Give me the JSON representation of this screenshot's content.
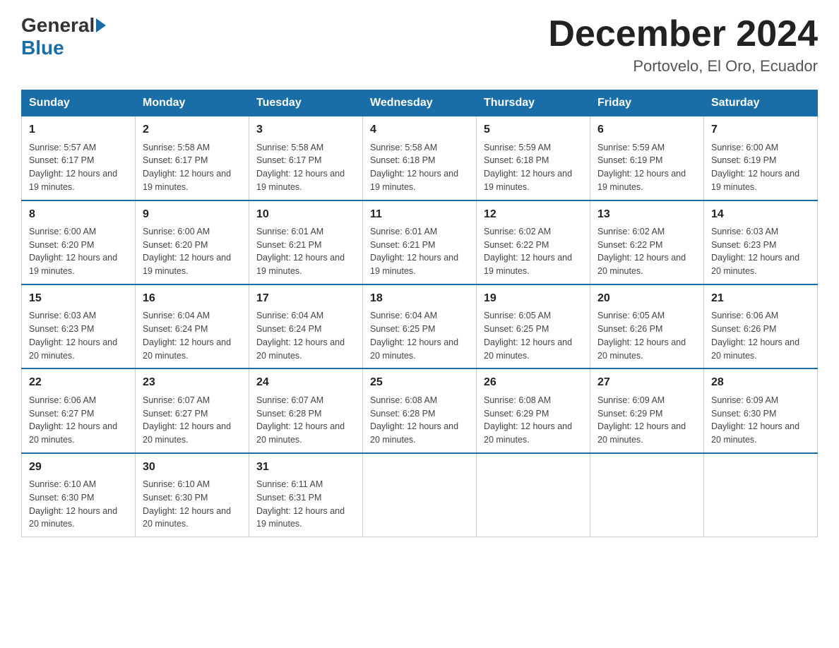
{
  "header": {
    "logo_general": "General",
    "logo_blue": "Blue",
    "month_year": "December 2024",
    "location": "Portovelo, El Oro, Ecuador"
  },
  "calendar": {
    "days_of_week": [
      "Sunday",
      "Monday",
      "Tuesday",
      "Wednesday",
      "Thursday",
      "Friday",
      "Saturday"
    ],
    "weeks": [
      [
        {
          "day": "1",
          "sunrise": "5:57 AM",
          "sunset": "6:17 PM",
          "daylight": "12 hours and 19 minutes."
        },
        {
          "day": "2",
          "sunrise": "5:58 AM",
          "sunset": "6:17 PM",
          "daylight": "12 hours and 19 minutes."
        },
        {
          "day": "3",
          "sunrise": "5:58 AM",
          "sunset": "6:17 PM",
          "daylight": "12 hours and 19 minutes."
        },
        {
          "day": "4",
          "sunrise": "5:58 AM",
          "sunset": "6:18 PM",
          "daylight": "12 hours and 19 minutes."
        },
        {
          "day": "5",
          "sunrise": "5:59 AM",
          "sunset": "6:18 PM",
          "daylight": "12 hours and 19 minutes."
        },
        {
          "day": "6",
          "sunrise": "5:59 AM",
          "sunset": "6:19 PM",
          "daylight": "12 hours and 19 minutes."
        },
        {
          "day": "7",
          "sunrise": "6:00 AM",
          "sunset": "6:19 PM",
          "daylight": "12 hours and 19 minutes."
        }
      ],
      [
        {
          "day": "8",
          "sunrise": "6:00 AM",
          "sunset": "6:20 PM",
          "daylight": "12 hours and 19 minutes."
        },
        {
          "day": "9",
          "sunrise": "6:00 AM",
          "sunset": "6:20 PM",
          "daylight": "12 hours and 19 minutes."
        },
        {
          "day": "10",
          "sunrise": "6:01 AM",
          "sunset": "6:21 PM",
          "daylight": "12 hours and 19 minutes."
        },
        {
          "day": "11",
          "sunrise": "6:01 AM",
          "sunset": "6:21 PM",
          "daylight": "12 hours and 19 minutes."
        },
        {
          "day": "12",
          "sunrise": "6:02 AM",
          "sunset": "6:22 PM",
          "daylight": "12 hours and 19 minutes."
        },
        {
          "day": "13",
          "sunrise": "6:02 AM",
          "sunset": "6:22 PM",
          "daylight": "12 hours and 20 minutes."
        },
        {
          "day": "14",
          "sunrise": "6:03 AM",
          "sunset": "6:23 PM",
          "daylight": "12 hours and 20 minutes."
        }
      ],
      [
        {
          "day": "15",
          "sunrise": "6:03 AM",
          "sunset": "6:23 PM",
          "daylight": "12 hours and 20 minutes."
        },
        {
          "day": "16",
          "sunrise": "6:04 AM",
          "sunset": "6:24 PM",
          "daylight": "12 hours and 20 minutes."
        },
        {
          "day": "17",
          "sunrise": "6:04 AM",
          "sunset": "6:24 PM",
          "daylight": "12 hours and 20 minutes."
        },
        {
          "day": "18",
          "sunrise": "6:04 AM",
          "sunset": "6:25 PM",
          "daylight": "12 hours and 20 minutes."
        },
        {
          "day": "19",
          "sunrise": "6:05 AM",
          "sunset": "6:25 PM",
          "daylight": "12 hours and 20 minutes."
        },
        {
          "day": "20",
          "sunrise": "6:05 AM",
          "sunset": "6:26 PM",
          "daylight": "12 hours and 20 minutes."
        },
        {
          "day": "21",
          "sunrise": "6:06 AM",
          "sunset": "6:26 PM",
          "daylight": "12 hours and 20 minutes."
        }
      ],
      [
        {
          "day": "22",
          "sunrise": "6:06 AM",
          "sunset": "6:27 PM",
          "daylight": "12 hours and 20 minutes."
        },
        {
          "day": "23",
          "sunrise": "6:07 AM",
          "sunset": "6:27 PM",
          "daylight": "12 hours and 20 minutes."
        },
        {
          "day": "24",
          "sunrise": "6:07 AM",
          "sunset": "6:28 PM",
          "daylight": "12 hours and 20 minutes."
        },
        {
          "day": "25",
          "sunrise": "6:08 AM",
          "sunset": "6:28 PM",
          "daylight": "12 hours and 20 minutes."
        },
        {
          "day": "26",
          "sunrise": "6:08 AM",
          "sunset": "6:29 PM",
          "daylight": "12 hours and 20 minutes."
        },
        {
          "day": "27",
          "sunrise": "6:09 AM",
          "sunset": "6:29 PM",
          "daylight": "12 hours and 20 minutes."
        },
        {
          "day": "28",
          "sunrise": "6:09 AM",
          "sunset": "6:30 PM",
          "daylight": "12 hours and 20 minutes."
        }
      ],
      [
        {
          "day": "29",
          "sunrise": "6:10 AM",
          "sunset": "6:30 PM",
          "daylight": "12 hours and 20 minutes."
        },
        {
          "day": "30",
          "sunrise": "6:10 AM",
          "sunset": "6:30 PM",
          "daylight": "12 hours and 20 minutes."
        },
        {
          "day": "31",
          "sunrise": "6:11 AM",
          "sunset": "6:31 PM",
          "daylight": "12 hours and 19 minutes."
        },
        null,
        null,
        null,
        null
      ]
    ]
  }
}
